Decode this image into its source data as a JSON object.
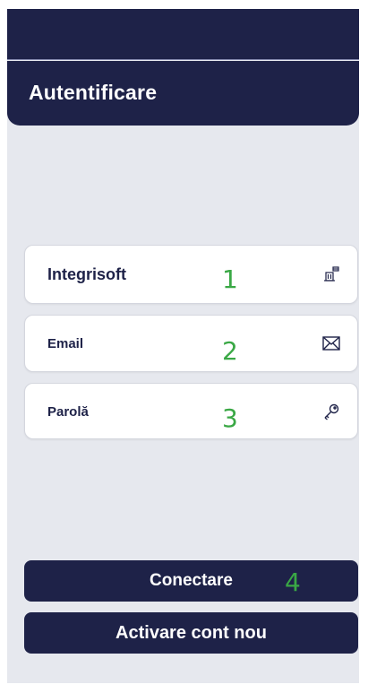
{
  "header": {
    "title": "Autentificare"
  },
  "fields": [
    {
      "label": "Integrisoft",
      "icon": "company-icon"
    },
    {
      "label": "Email",
      "icon": "envelope-icon"
    },
    {
      "label": "Parolă",
      "icon": "key-icon"
    }
  ],
  "markers": [
    "1",
    "2",
    "3",
    "4"
  ],
  "buttons": {
    "login_label": "Conectare",
    "activate_label": "Activare cont nou"
  },
  "colors": {
    "primary": "#1e2248",
    "background": "#e6e8ee",
    "marker": "#3aa845"
  }
}
